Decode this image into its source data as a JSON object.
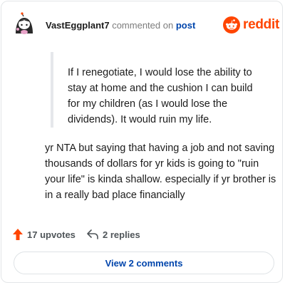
{
  "header": {
    "username": "VastEggplant7",
    "action_text": "commented on",
    "post_link": "post",
    "brand_name": "reddit"
  },
  "quote": {
    "text": "If I renegotiate, I would lose the ability to stay at home and the cushion I can build for my children (as I would lose the dividends). It would ruin my life."
  },
  "comment": {
    "text": "yr NTA but saying that having a job and not saving thousands of dollars for yr kids is going to \"ruin your life\" is kinda shallow. especially if yr brother is in a really bad place financially"
  },
  "actions": {
    "upvotes_label": "17 upvotes",
    "replies_label": "2 replies"
  },
  "footer": {
    "view_comments_label": "View 2 comments"
  },
  "icons": {
    "avatar": "avatar-icon",
    "brand": "reddit-logo-icon",
    "upvote": "upvote-arrow-icon",
    "reply": "reply-arrow-icon"
  },
  "colors": {
    "brand": "#ff4500",
    "link": "#0045ac",
    "muted": "#7c7c7c",
    "quote_bar": "#e5e7eb"
  }
}
